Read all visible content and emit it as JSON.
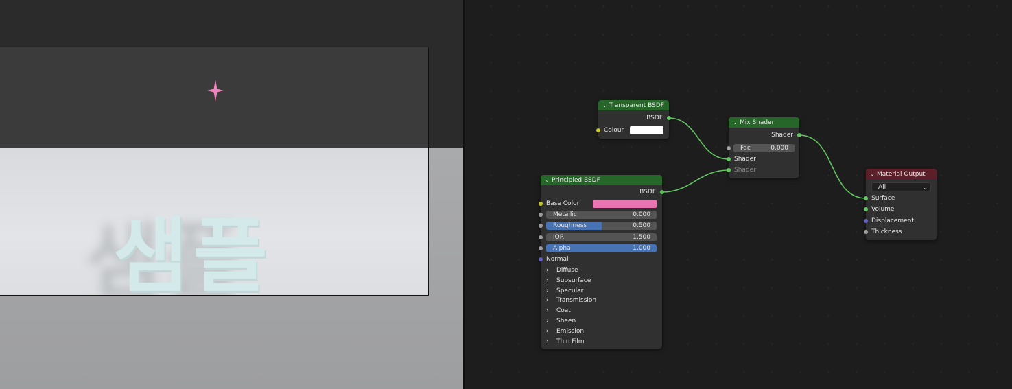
{
  "viewport": {
    "text_3d": "샘플",
    "sparkle_icon": "sparkle-star-icon",
    "colors": {
      "top": "#2b2b2b",
      "camera_top": "#3b3b3b",
      "floor": "#e0e2e5",
      "lower": "#a3a4a6",
      "text": "#d3e9ea",
      "sparkle": "#ee83bb"
    }
  },
  "nodes": {
    "transparent_bsdf": {
      "title": "Transparent BSDF",
      "output_label": "BSDF",
      "colour_label": "Colour",
      "colour_value": "#ffffff"
    },
    "mix_shader": {
      "title": "Mix Shader",
      "output_label": "Shader",
      "fac_label": "Fac",
      "fac_value": "0.000",
      "shader1_label": "Shader",
      "shader2_label": "Shader"
    },
    "principled_bsdf": {
      "title": "Principled BSDF",
      "output_label": "BSDF",
      "base_color_label": "Base Color",
      "base_color_value": "#ea73b2",
      "fields": [
        {
          "label": "Metallic",
          "value": "0.000",
          "fill": 0.0
        },
        {
          "label": "Roughness",
          "value": "0.500",
          "fill": 0.5
        },
        {
          "label": "IOR",
          "value": "1.500",
          "fill": 0.0
        },
        {
          "label": "Alpha",
          "value": "1.000",
          "fill": 1.0
        }
      ],
      "normal_label": "Normal",
      "panels": [
        "Diffuse",
        "Subsurface",
        "Specular",
        "Transmission",
        "Coat",
        "Sheen",
        "Emission",
        "Thin Film"
      ]
    },
    "material_output": {
      "title": "Material Output",
      "target_select": "All",
      "inputs": [
        "Surface",
        "Volume",
        "Displacement",
        "Thickness"
      ]
    }
  },
  "colors": {
    "shader_header": "#266628",
    "output_header": "#5a1f28",
    "shader_socket": "#63c763",
    "color_socket": "#c7c729",
    "value_socket": "#a1a1a1",
    "vector_socket": "#6363c7",
    "link": "#63c763",
    "slider_fill": "#4772b3"
  }
}
